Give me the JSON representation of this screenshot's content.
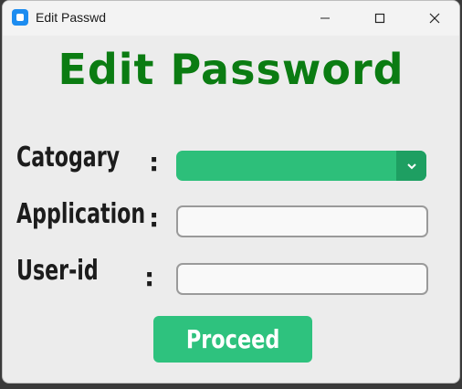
{
  "window": {
    "title": "Edit Passwd",
    "icon": "app-icon"
  },
  "heading": "Edit Password",
  "form": {
    "category": {
      "label": "Catogary",
      "colon": ":",
      "value": ""
    },
    "application": {
      "label": "Application",
      "colon": ":",
      "value": ""
    },
    "userid": {
      "label": "User-id",
      "colon": ":",
      "value": ""
    }
  },
  "proceed_label": "Proceed",
  "colors": {
    "heading": "#0b7c12",
    "accent": "#2ec27e",
    "accent_dark": "#1e9f62"
  }
}
